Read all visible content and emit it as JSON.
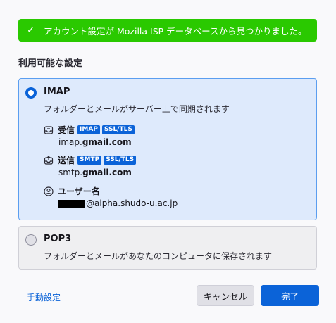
{
  "banner": {
    "icon": "check-icon",
    "text": "アカウント設定が Mozilla ISP データベースから見つかりました。"
  },
  "section_title": "利用可能な設定",
  "imap": {
    "title": "IMAP",
    "selected": true,
    "description": "フォルダーとメールがサーバー上で同期されます",
    "incoming": {
      "icon": "inbox-icon",
      "label": "受信",
      "badges": [
        "IMAP",
        "SSL/TLS"
      ],
      "host_prefix": "imap.",
      "host_domain": "gmail.com"
    },
    "outgoing": {
      "icon": "outbox-icon",
      "label": "送信",
      "badges": [
        "SMTP",
        "SSL/TLS"
      ],
      "host_prefix": "smtp.",
      "host_domain": "gmail.com"
    },
    "username": {
      "icon": "user-icon",
      "label": "ユーザー名",
      "value_suffix": "@alpha.shudo-u.ac.jp"
    }
  },
  "pop3": {
    "title": "POP3",
    "selected": false,
    "description": "フォルダーとメールがあなたのコンピュータに保存されます"
  },
  "footer": {
    "manual_link": "手動設定",
    "cancel_label": "キャンセル",
    "done_label": "完了"
  },
  "colors": {
    "banner": "#2ac900",
    "accent": "#0b63d8",
    "selected_card": "#deeafc"
  }
}
